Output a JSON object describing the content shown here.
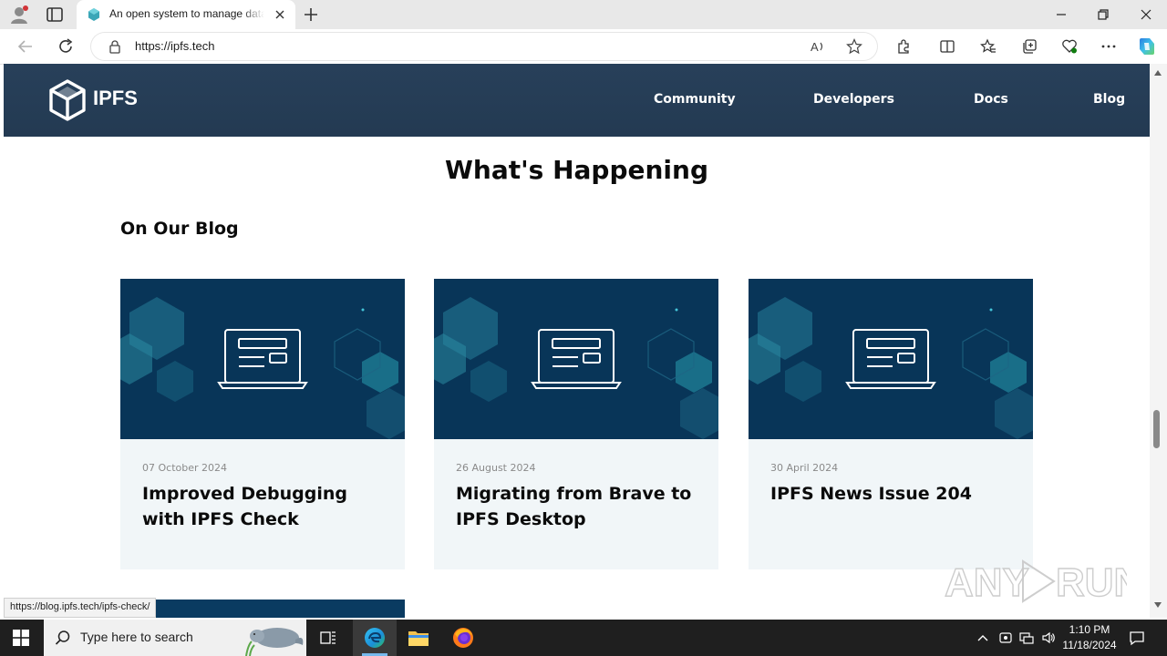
{
  "browser": {
    "tab_title": "An open system to manage data without a central server",
    "url": "https://ipfs.tech",
    "status_url": "https://blog.ipfs.tech/ipfs-check/"
  },
  "site": {
    "logo_text": "IPFS",
    "nav": [
      {
        "label": "Community"
      },
      {
        "label": "Developers"
      },
      {
        "label": "Docs"
      },
      {
        "label": "Blog"
      }
    ],
    "section_title": "What's Happening",
    "blog_heading": "On Our Blog",
    "cards": [
      {
        "date": "07 October 2024",
        "title": "Improved Debugging with IPFS Check"
      },
      {
        "date": "26 August 2024",
        "title": "Migrating from Brave to IPFS Desktop"
      },
      {
        "date": "30 April 2024",
        "title": "IPFS News Issue 204"
      }
    ]
  },
  "watermark": "ANY RUN",
  "taskbar": {
    "search_placeholder": "Type here to search",
    "time": "1:10 PM",
    "date": "11/18/2024"
  },
  "colors": {
    "header_bg": "#263d56",
    "card_bg": "#f1f6f8",
    "card_image_bg": "#0a3b61",
    "accent_teal": "#2fb3c4"
  }
}
